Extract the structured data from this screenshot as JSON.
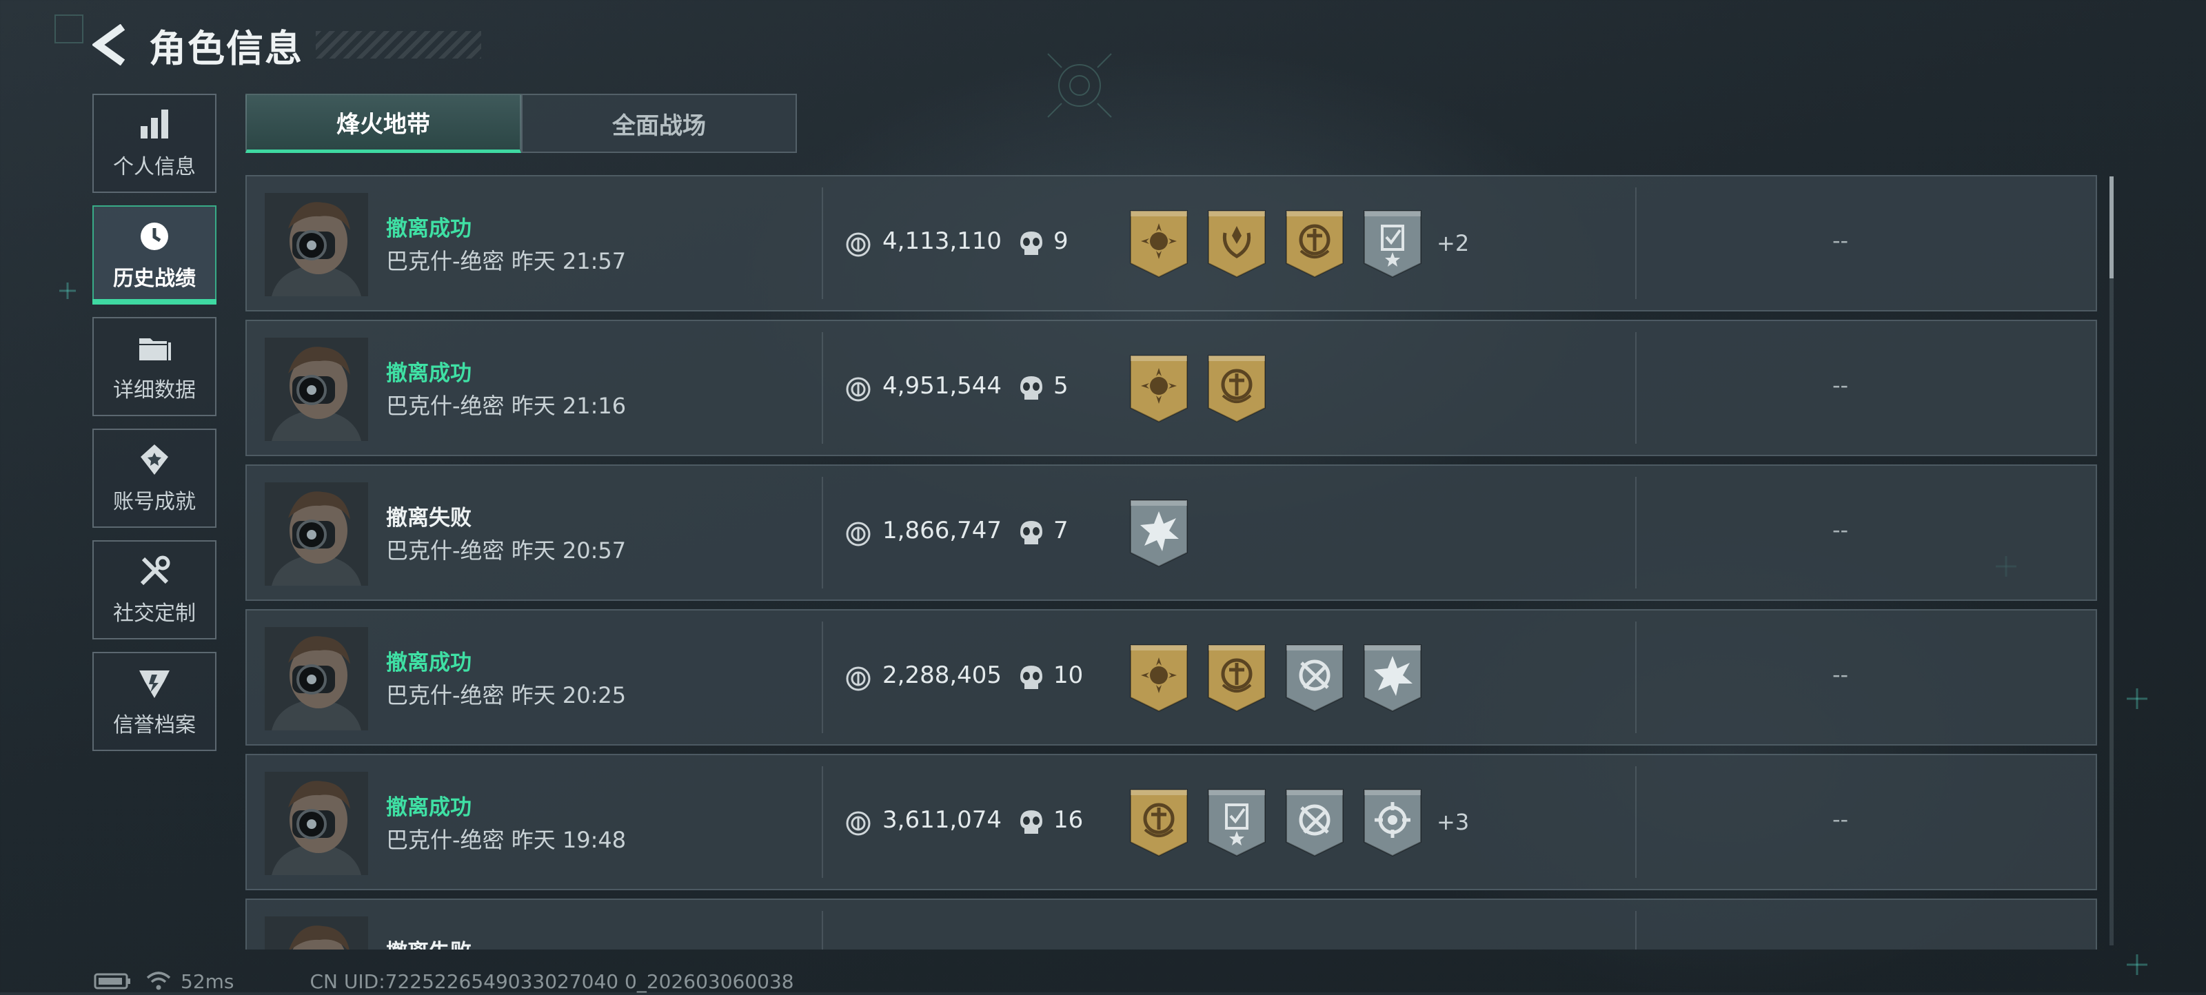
{
  "header": {
    "title": "角色信息"
  },
  "sidebar": {
    "items": [
      {
        "label": "个人信息",
        "icon": "bar-chart-icon",
        "active": false
      },
      {
        "label": "历史战绩",
        "icon": "history-clock-icon",
        "active": true
      },
      {
        "label": "详细数据",
        "icon": "folder-icon",
        "active": false
      },
      {
        "label": "账号成就",
        "icon": "achievement-icon",
        "active": false
      },
      {
        "label": "社交定制",
        "icon": "tools-icon",
        "active": false
      },
      {
        "label": "信誉档案",
        "icon": "reputation-icon",
        "active": false
      }
    ]
  },
  "tabs": [
    {
      "label": "烽火地带",
      "active": true
    },
    {
      "label": "全面战场",
      "active": false
    }
  ],
  "matches": [
    {
      "status": "撤离成功",
      "success": true,
      "meta": "巴克什-绝密 昨天 21:57",
      "value": "4,113,110",
      "kills": "9",
      "badges": [
        "gold-sun-badge",
        "gold-wreath-badge",
        "gold-emblem-badge",
        "silver-checklist-badge"
      ],
      "extra": "+2",
      "dash": "--"
    },
    {
      "status": "撤离成功",
      "success": true,
      "meta": "巴克什-绝密 昨天 21:16",
      "value": "4,951,544",
      "kills": "5",
      "badges": [
        "gold-sun-badge",
        "gold-emblem-badge"
      ],
      "extra": "",
      "dash": "--"
    },
    {
      "status": "撤离失败",
      "success": false,
      "meta": "巴克什-绝密 昨天 20:57",
      "value": "1,866,747",
      "kills": "7",
      "badges": [
        "silver-burst-badge"
      ],
      "extra": "",
      "dash": "--"
    },
    {
      "status": "撤离成功",
      "success": true,
      "meta": "巴克什-绝密 昨天 20:25",
      "value": "2,288,405",
      "kills": "10",
      "badges": [
        "gold-sun-badge",
        "gold-emblem-badge",
        "silver-target-badge",
        "silver-burst-badge"
      ],
      "extra": "",
      "dash": "--"
    },
    {
      "status": "撤离成功",
      "success": true,
      "meta": "巴克什-绝密 昨天 19:48",
      "value": "3,611,074",
      "kills": "16",
      "badges": [
        "gold-emblem-badge",
        "silver-checklist-badge",
        "silver-target-badge",
        "silver-crosshair-badge"
      ],
      "extra": "+3",
      "dash": "--"
    },
    {
      "status": "撤离失败",
      "success": false,
      "meta": "",
      "value": "",
      "kills": "",
      "badges": [],
      "extra": "",
      "dash": ""
    }
  ],
  "footer": {
    "ping": "52ms",
    "uid": "CN UID:7225226549033027040 0_202603060038"
  },
  "colors": {
    "accent": "#3fd9a2",
    "gold": "#b99a52",
    "silver": "#7c8b91"
  }
}
